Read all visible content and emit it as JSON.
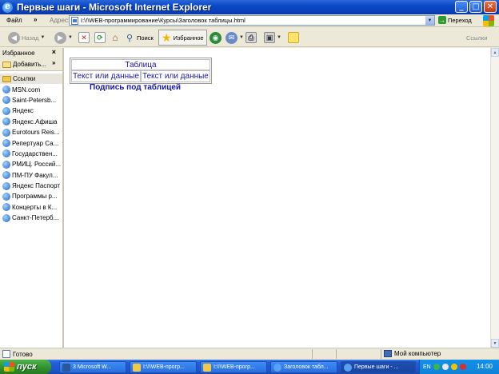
{
  "window": {
    "title": "Первые шаги - Microsoft Internet Explorer",
    "minimize": "_",
    "maximize": "□",
    "close": "✕"
  },
  "menu": {
    "file": "Файл",
    "chevron": "»"
  },
  "address": {
    "label": "Адрес:",
    "value": "I:\\!\\WEB-программирование\\Курсы\\Заголовок таблицы.html",
    "go_label": "Переход"
  },
  "toolbar": {
    "back": "Назад",
    "search": "Поиск",
    "favorites": "Избранное",
    "links": "Ссылки"
  },
  "sidebar": {
    "title": "Избранное",
    "close": "×",
    "add": "Добавить...",
    "items": [
      "Ссылки",
      "MSN.com",
      "Saint-Petersb...",
      "Яндекс",
      "Яндекс.Афиша",
      "Eurotours Reis...",
      "Репертуар Са...",
      "Государствен...",
      "РМИЦ. Россий...",
      "ПМ-ПУ Факул...",
      "Яндекс Паспорт",
      "Программы р...",
      "Концерты в К...",
      "Санкт-Петерб..."
    ]
  },
  "page": {
    "table_caption": "Таблица",
    "cell1": "Текст или данные",
    "cell2": "Текст или данные",
    "caption_below": "Подпись под таблицей"
  },
  "status": {
    "left": "Готово",
    "zone": "Мой компьютер"
  },
  "taskbar": {
    "start": "пуск",
    "tasks": [
      "3 Microsoft W...",
      "I:\\!\\WEB-прогр...",
      "I:\\!\\WEB-прогр...",
      "Заголовок табл...",
      "Первые шаги - ..."
    ],
    "lang": "EN",
    "clock": "14:00"
  }
}
